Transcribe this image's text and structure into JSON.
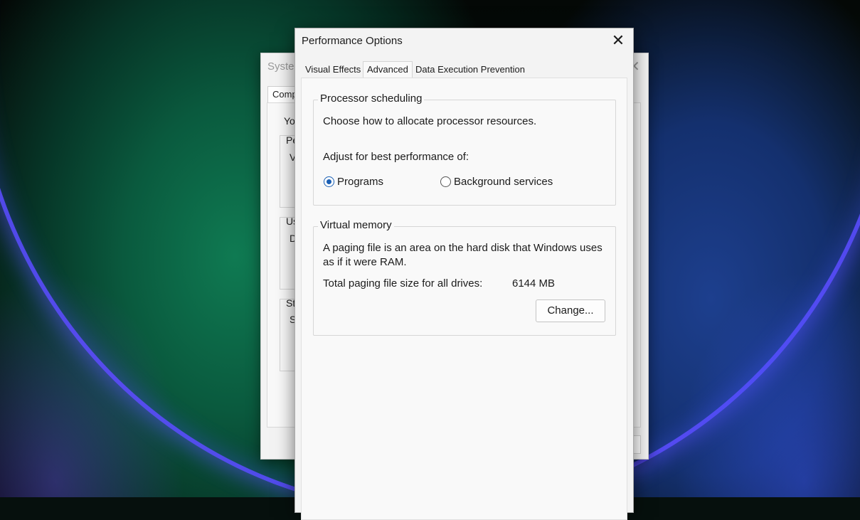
{
  "background_window": {
    "title": "Syster",
    "close_glyph": "✕",
    "tab": "Comp",
    "partial_texts": [
      "Yo",
      "Pe",
      "V",
      "Us",
      "D",
      "St",
      "S"
    ]
  },
  "dialog": {
    "title": "Performance Options",
    "close_glyph": "✕",
    "tabs": [
      {
        "label": "Visual Effects",
        "active": false
      },
      {
        "label": "Advanced",
        "active": true
      },
      {
        "label": "Data Execution Prevention",
        "active": false
      }
    ],
    "processor_scheduling": {
      "legend": "Processor scheduling",
      "description": "Choose how to allocate processor resources.",
      "adjust_label": "Adjust for best performance of:",
      "options": [
        {
          "label": "Programs",
          "checked": true
        },
        {
          "label": "Background services",
          "checked": false
        }
      ]
    },
    "virtual_memory": {
      "legend": "Virtual memory",
      "description_line1": "A paging file is an area on the hard disk that Windows uses",
      "description_line2": "as if it were RAM.",
      "total_label": "Total paging file size for all drives:",
      "total_value": "6144 MB",
      "change_button": "Change..."
    }
  },
  "colors": {
    "accent": "#1a5fb4",
    "dialog_bg": "#f3f3f3",
    "panel_bg": "#f9f9f9"
  }
}
